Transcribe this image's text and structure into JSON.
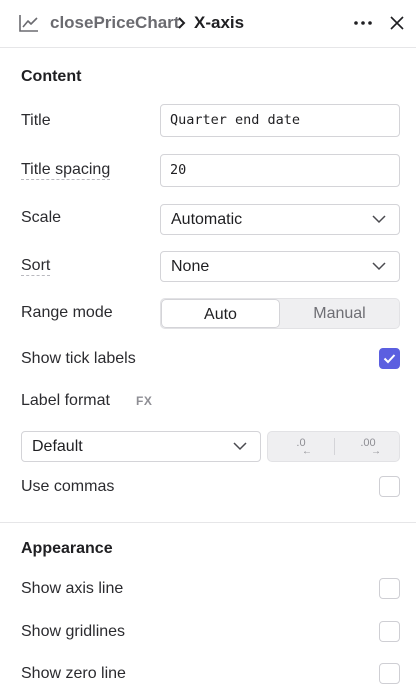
{
  "header": {
    "parent": "closePriceChart",
    "current": "X-axis"
  },
  "content": {
    "section_title": "Content",
    "title_label": "Title",
    "title_value": "Quarter end date",
    "title_spacing_label": "Title spacing",
    "title_spacing_value": "20",
    "scale_label": "Scale",
    "scale_value": "Automatic",
    "sort_label": "Sort",
    "sort_value": "None",
    "range_mode_label": "Range mode",
    "range_auto": "Auto",
    "range_manual": "Manual",
    "range_mode_selected": "Auto",
    "show_tick_labels_label": "Show tick labels",
    "show_tick_labels": true,
    "label_format_label": "Label format",
    "fx_label": "FX",
    "format_value": "Default",
    "decrease_decimals": ".0",
    "increase_decimals": ".00",
    "use_commas_label": "Use commas",
    "use_commas": false
  },
  "appearance": {
    "section_title": "Appearance",
    "show_axis_line_label": "Show axis line",
    "show_axis_line": false,
    "show_gridlines_label": "Show gridlines",
    "show_gridlines": false,
    "show_zero_line_label": "Show zero line",
    "show_zero_line": false
  },
  "colors": {
    "accent": "#5b5fe0"
  },
  "icons": [
    "line-chart-icon",
    "chevron-right-icon",
    "more-icon",
    "close-icon",
    "chevron-down-icon",
    "checkmark-icon",
    "arrow-left-icon",
    "arrow-right-icon"
  ]
}
